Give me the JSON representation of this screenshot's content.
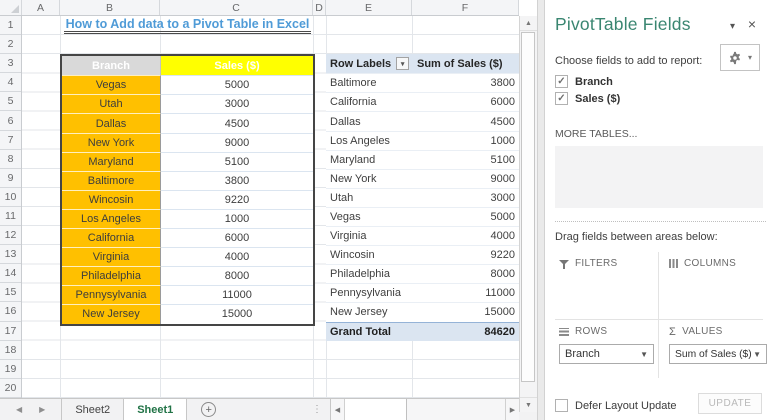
{
  "colors": {
    "accent-orange": "#FFC000",
    "accent-yellow": "#FFFF00",
    "header-gray": "#D9D9D9",
    "pivot-blue": "#DBE5F1",
    "title-blue": "#4F9BD7",
    "pane-teal": "#3A8671",
    "excel-green": "#217346"
  },
  "sheet": {
    "title": "How to Add data to a Pivot Table in Excel",
    "column_letters": [
      "A",
      "B",
      "C",
      "D",
      "E",
      "F"
    ],
    "row_numbers": [
      "1",
      "2",
      "3",
      "4",
      "5",
      "6",
      "7",
      "8",
      "9",
      "10",
      "11",
      "12",
      "13",
      "14",
      "15",
      "16",
      "17",
      "18",
      "19",
      "20"
    ],
    "left_table": {
      "headers": {
        "branch": "Branch",
        "sales": "Sales ($)"
      },
      "rows": [
        {
          "branch": "Vegas",
          "sales": "5000"
        },
        {
          "branch": "Utah",
          "sales": "3000"
        },
        {
          "branch": "Dallas",
          "sales": "4500"
        },
        {
          "branch": "New York",
          "sales": "9000"
        },
        {
          "branch": "Maryland",
          "sales": "5100"
        },
        {
          "branch": "Baltimore",
          "sales": "3800"
        },
        {
          "branch": "Wincosin",
          "sales": "9220"
        },
        {
          "branch": "Los Angeles",
          "sales": "1000"
        },
        {
          "branch": "California",
          "sales": "6000"
        },
        {
          "branch": "Virginia",
          "sales": "4000"
        },
        {
          "branch": "Philadelphia",
          "sales": "8000"
        },
        {
          "branch": "Pennysylvania",
          "sales": "11000"
        },
        {
          "branch": "New Jersey",
          "sales": "15000"
        }
      ]
    },
    "pivot_table": {
      "headers": {
        "row_labels": "Row Labels",
        "values": "Sum of Sales ($)"
      },
      "rows": [
        {
          "label": "Baltimore",
          "value": "3800"
        },
        {
          "label": "California",
          "value": "6000"
        },
        {
          "label": "Dallas",
          "value": "4500"
        },
        {
          "label": "Los Angeles",
          "value": "1000"
        },
        {
          "label": "Maryland",
          "value": "5100"
        },
        {
          "label": "New York",
          "value": "9000"
        },
        {
          "label": "Utah",
          "value": "3000"
        },
        {
          "label": "Vegas",
          "value": "5000"
        },
        {
          "label": "Virginia",
          "value": "4000"
        },
        {
          "label": "Wincosin",
          "value": "9220"
        },
        {
          "label": "Philadelphia",
          "value": "8000"
        },
        {
          "label": "Pennysylvania",
          "value": "11000"
        },
        {
          "label": "New Jersey",
          "value": "15000"
        }
      ],
      "grand_total": {
        "label": "Grand Total",
        "value": "84620"
      }
    }
  },
  "tab_bar": {
    "tabs": [
      {
        "label": "Sheet2",
        "active": false
      },
      {
        "label": "Sheet1",
        "active": true
      }
    ]
  },
  "pane": {
    "title": "PivotTable Fields",
    "choose_label": "Choose fields to add to report:",
    "fields": [
      {
        "label": "Branch",
        "checked": true
      },
      {
        "label": "Sales ($)",
        "checked": true
      }
    ],
    "more_tables": "MORE TABLES...",
    "drag_label": "Drag fields between areas below:",
    "areas": {
      "filters": "FILTERS",
      "columns": "COLUMNS",
      "rows": "ROWS",
      "values": "VALUES"
    },
    "rows_field": "Branch",
    "values_field": "Sum of Sales ($)",
    "defer_label": "Defer Layout Update",
    "update_label": "UPDATE"
  }
}
